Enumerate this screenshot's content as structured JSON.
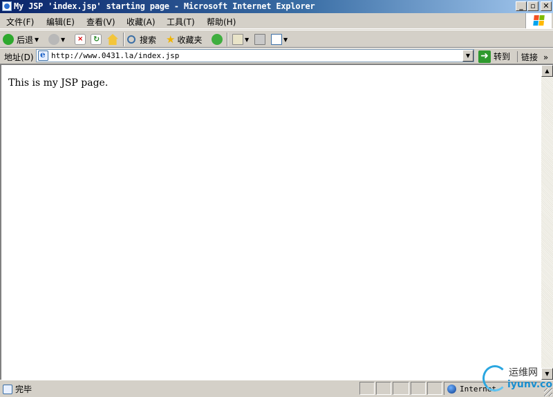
{
  "window": {
    "title": "My JSP 'index.jsp' starting page - Microsoft Internet Explorer",
    "buttons": {
      "minimize": "_",
      "maximize": "▫",
      "close": "✕"
    }
  },
  "menu": [
    "文件(F)",
    "编辑(E)",
    "查看(V)",
    "收藏(A)",
    "工具(T)",
    "帮助(H)"
  ],
  "toolbar": {
    "back": "后退",
    "search": "搜索",
    "favorites": "收藏夹"
  },
  "address": {
    "label": "地址(D)",
    "url": "http://www.0431.la/index.jsp",
    "go": "转到",
    "links": "链接"
  },
  "page": {
    "body_text": "This is my JSP page."
  },
  "status": {
    "text": "完毕",
    "zone": "Internet"
  },
  "watermark": {
    "cn": "运维网",
    "en": "iyunv.com"
  },
  "colors": {
    "titlebar_start": "#0a246a",
    "titlebar_end": "#a6caf0",
    "chrome": "#d4d0c8",
    "go_green": "#2e9a2e"
  }
}
